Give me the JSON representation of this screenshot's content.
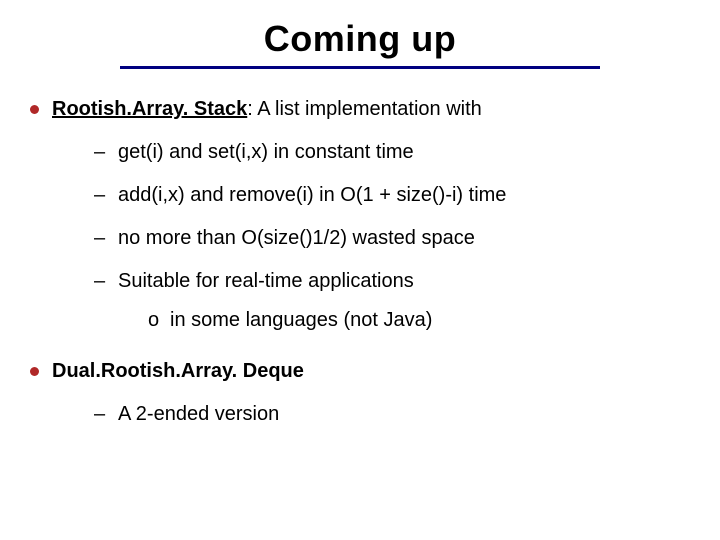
{
  "title": "Coming up",
  "bullets": {
    "b1": {
      "head": "Rootish.Array. Stack",
      "rest": ": A list implementation with",
      "sub": [
        "get(i) and set(i,x) in constant time",
        "add(i,x) and remove(i) in O(1 + size()-i) time",
        "no more than O(size()1/2) wasted space",
        "Suitable for real-time applications"
      ],
      "subsub": "in some languages (not Java)"
    },
    "b2": {
      "head": "Dual.Rootish.Array. Deque",
      "sub": [
        "A 2-ended version"
      ]
    }
  },
  "glyphs": {
    "dash": "–",
    "circle": "o"
  }
}
